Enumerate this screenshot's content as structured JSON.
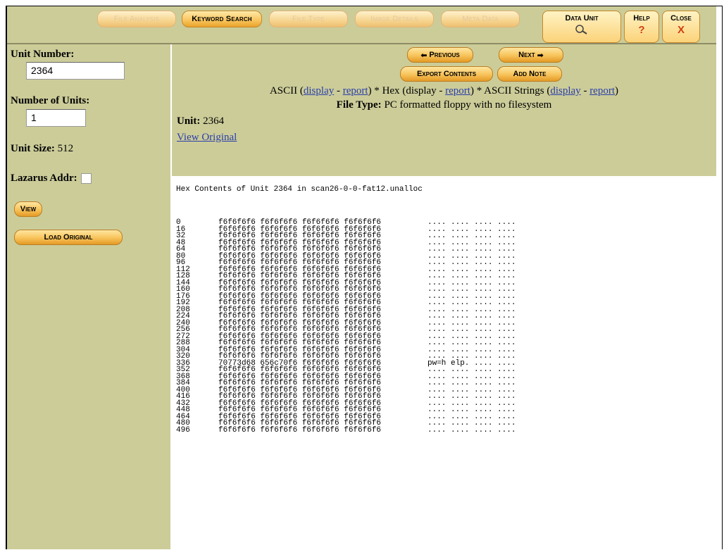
{
  "nav": {
    "file_analysis": "File Analysis",
    "keyword_search": "Keyword Search",
    "file_type": "File Type",
    "image_details": "Image Details",
    "meta_data": "Meta Data",
    "data_unit": "Data Unit",
    "data_unit_icon": "magnifier-icon",
    "help": "Help",
    "help_symbol": "?",
    "close": "Close",
    "close_symbol": "X"
  },
  "sidebar": {
    "unit_number_label": "Unit Number:",
    "unit_number_value": "2364",
    "num_units_label": "Number of Units:",
    "num_units_value": "1",
    "unit_size_label": "Unit Size:",
    "unit_size_value": "512",
    "lazarus_label": "Lazarus Addr:",
    "view_button": "View",
    "load_original_button": "Load Original"
  },
  "header": {
    "previous_button": "Previous",
    "next_button": "Next",
    "export_button": "Export Contents",
    "add_note_button": "Add Note",
    "ascii_label": "ASCII",
    "display": "display",
    "report": "report",
    "hex_label": "Hex",
    "ascii_strings_label": "ASCII Strings",
    "file_type_label": "File Type:",
    "file_type_value": "PC formatted floppy with no filesystem",
    "unit_label": "Unit:",
    "unit_value": "2364",
    "view_original": "View Original"
  },
  "content": {
    "title": "Hex Contents of Unit 2364 in scan26-0-0-fat12.unalloc",
    "rows": [
      {
        "off": "0",
        "hex": "f6f6f6f6 f6f6f6f6 f6f6f6f6 f6f6f6f6",
        "ascii": ".... .... .... ...."
      },
      {
        "off": "16",
        "hex": "f6f6f6f6 f6f6f6f6 f6f6f6f6 f6f6f6f6",
        "ascii": ".... .... .... ...."
      },
      {
        "off": "32",
        "hex": "f6f6f6f6 f6f6f6f6 f6f6f6f6 f6f6f6f6",
        "ascii": ".... .... .... ...."
      },
      {
        "off": "48",
        "hex": "f6f6f6f6 f6f6f6f6 f6f6f6f6 f6f6f6f6",
        "ascii": ".... .... .... ...."
      },
      {
        "off": "64",
        "hex": "f6f6f6f6 f6f6f6f6 f6f6f6f6 f6f6f6f6",
        "ascii": ".... .... .... ...."
      },
      {
        "off": "80",
        "hex": "f6f6f6f6 f6f6f6f6 f6f6f6f6 f6f6f6f6",
        "ascii": ".... .... .... ...."
      },
      {
        "off": "96",
        "hex": "f6f6f6f6 f6f6f6f6 f6f6f6f6 f6f6f6f6",
        "ascii": ".... .... .... ...."
      },
      {
        "off": "112",
        "hex": "f6f6f6f6 f6f6f6f6 f6f6f6f6 f6f6f6f6",
        "ascii": ".... .... .... ...."
      },
      {
        "off": "128",
        "hex": "f6f6f6f6 f6f6f6f6 f6f6f6f6 f6f6f6f6",
        "ascii": ".... .... .... ...."
      },
      {
        "off": "144",
        "hex": "f6f6f6f6 f6f6f6f6 f6f6f6f6 f6f6f6f6",
        "ascii": ".... .... .... ...."
      },
      {
        "off": "160",
        "hex": "f6f6f6f6 f6f6f6f6 f6f6f6f6 f6f6f6f6",
        "ascii": ".... .... .... ...."
      },
      {
        "off": "176",
        "hex": "f6f6f6f6 f6f6f6f6 f6f6f6f6 f6f6f6f6",
        "ascii": ".... .... .... ...."
      },
      {
        "off": "192",
        "hex": "f6f6f6f6 f6f6f6f6 f6f6f6f6 f6f6f6f6",
        "ascii": ".... .... .... ...."
      },
      {
        "off": "208",
        "hex": "f6f6f6f6 f6f6f6f6 f6f6f6f6 f6f6f6f6",
        "ascii": ".... .... .... ...."
      },
      {
        "off": "224",
        "hex": "f6f6f6f6 f6f6f6f6 f6f6f6f6 f6f6f6f6",
        "ascii": ".... .... .... ...."
      },
      {
        "off": "240",
        "hex": "f6f6f6f6 f6f6f6f6 f6f6f6f6 f6f6f6f6",
        "ascii": ".... .... .... ...."
      },
      {
        "off": "256",
        "hex": "f6f6f6f6 f6f6f6f6 f6f6f6f6 f6f6f6f6",
        "ascii": ".... .... .... ...."
      },
      {
        "off": "272",
        "hex": "f6f6f6f6 f6f6f6f6 f6f6f6f6 f6f6f6f6",
        "ascii": ".... .... .... ...."
      },
      {
        "off": "288",
        "hex": "f6f6f6f6 f6f6f6f6 f6f6f6f6 f6f6f6f6",
        "ascii": ".... .... .... ...."
      },
      {
        "off": "304",
        "hex": "f6f6f6f6 f6f6f6f6 f6f6f6f6 f6f6f6f6",
        "ascii": ".... .... .... ...."
      },
      {
        "off": "320",
        "hex": "f6f6f6f6 f6f6f6f6 f6f6f6f6 f6f6f6f6",
        "ascii": ".... .... .... ...."
      },
      {
        "off": "336",
        "hex": "70773d68 656c70f6 f6f6f6f6 f6f6f6f6",
        "ascii": "pw=h elp. .... ...."
      },
      {
        "off": "352",
        "hex": "f6f6f6f6 f6f6f6f6 f6f6f6f6 f6f6f6f6",
        "ascii": ".... .... .... ...."
      },
      {
        "off": "368",
        "hex": "f6f6f6f6 f6f6f6f6 f6f6f6f6 f6f6f6f6",
        "ascii": ".... .... .... ...."
      },
      {
        "off": "384",
        "hex": "f6f6f6f6 f6f6f6f6 f6f6f6f6 f6f6f6f6",
        "ascii": ".... .... .... ...."
      },
      {
        "off": "400",
        "hex": "f6f6f6f6 f6f6f6f6 f6f6f6f6 f6f6f6f6",
        "ascii": ".... .... .... ...."
      },
      {
        "off": "416",
        "hex": "f6f6f6f6 f6f6f6f6 f6f6f6f6 f6f6f6f6",
        "ascii": ".... .... .... ...."
      },
      {
        "off": "432",
        "hex": "f6f6f6f6 f6f6f6f6 f6f6f6f6 f6f6f6f6",
        "ascii": ".... .... .... ...."
      },
      {
        "off": "448",
        "hex": "f6f6f6f6 f6f6f6f6 f6f6f6f6 f6f6f6f6",
        "ascii": ".... .... .... ...."
      },
      {
        "off": "464",
        "hex": "f6f6f6f6 f6f6f6f6 f6f6f6f6 f6f6f6f6",
        "ascii": ".... .... .... ...."
      },
      {
        "off": "480",
        "hex": "f6f6f6f6 f6f6f6f6 f6f6f6f6 f6f6f6f6",
        "ascii": ".... .... .... ...."
      },
      {
        "off": "496",
        "hex": "f6f6f6f6 f6f6f6f6 f6f6f6f6 f6f6f6f6",
        "ascii": ".... .... .... ...."
      }
    ]
  }
}
